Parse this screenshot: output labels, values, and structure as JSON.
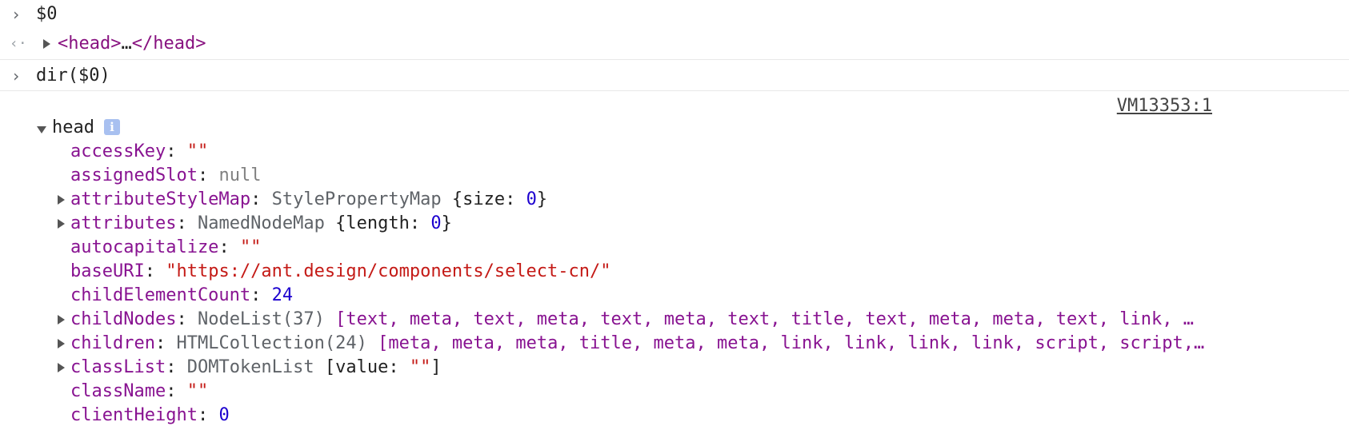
{
  "console": {
    "prompt_glyph": "›",
    "return_glyph": "‹·",
    "input1": "$0",
    "output1": {
      "open_tag": "<head>",
      "ellipsis": "…",
      "close_tag": "</head>"
    },
    "input2": "dir($0)",
    "source_link": "VM13353:1",
    "object_name": "head",
    "info_glyph": "i",
    "properties": [
      {
        "key": "accessKey",
        "value": "\"\"",
        "type": "str",
        "expandable": false
      },
      {
        "key": "assignedSlot",
        "value": "null",
        "type": "nul",
        "expandable": false
      },
      {
        "key": "attributeStyleMap",
        "prefix": "StylePropertyMap ",
        "value_pre": "{size: ",
        "value_num": "0",
        "value_post": "}",
        "expandable": true
      },
      {
        "key": "attributes",
        "prefix": "NamedNodeMap ",
        "value_pre": "{length: ",
        "value_num": "0",
        "value_post": "}",
        "expandable": true
      },
      {
        "key": "autocapitalize",
        "value": "\"\"",
        "type": "str",
        "expandable": false
      },
      {
        "key": "baseURI",
        "value": "\"https://ant.design/components/select-cn/\"",
        "type": "str",
        "expandable": false
      },
      {
        "key": "childElementCount",
        "value": "24",
        "type": "num",
        "expandable": false
      },
      {
        "key": "childNodes",
        "prefix": "NodeList(37) ",
        "list": "[text, meta, text, meta, text, meta, text, title, text, meta, meta, text, link, …",
        "expandable": true
      },
      {
        "key": "children",
        "prefix": "HTMLCollection(24) ",
        "list": "[meta, meta, meta, title, meta, meta, link, link, link, link, script, script,…",
        "expandable": true
      },
      {
        "key": "classList",
        "prefix": "DOMTokenList ",
        "value_pre": "[value: ",
        "value_str": "\"\"",
        "value_post": "]",
        "expandable": true
      },
      {
        "key": "className",
        "value": "\"\"",
        "type": "str",
        "expandable": false
      },
      {
        "key": "clientHeight",
        "value": "0",
        "type": "num",
        "expandable": false
      }
    ]
  }
}
